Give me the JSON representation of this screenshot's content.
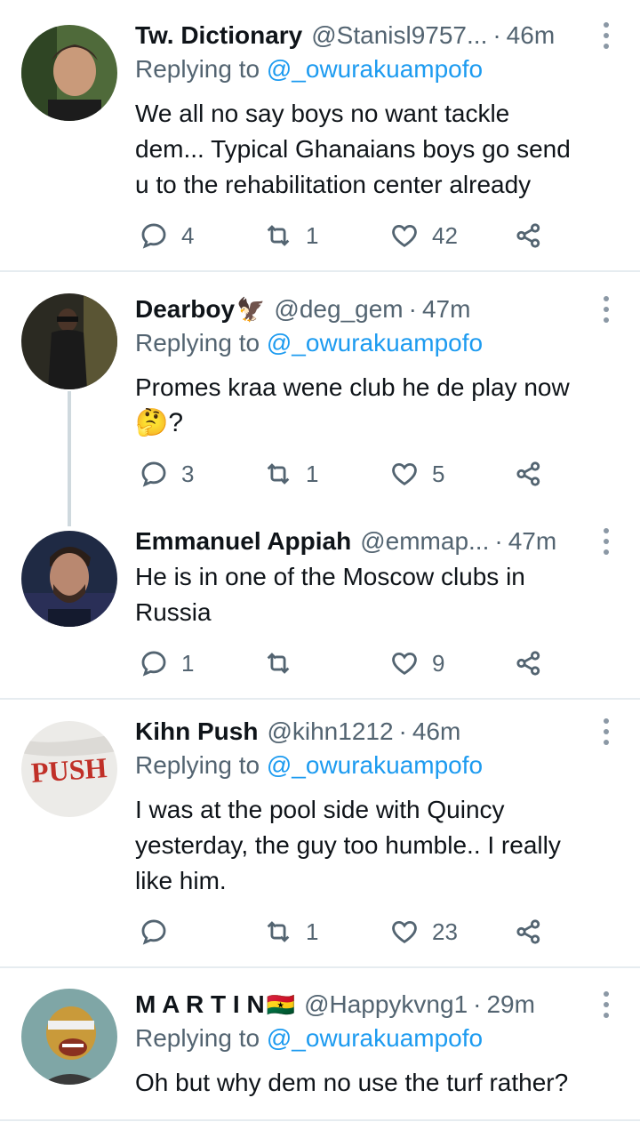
{
  "tweets": [
    {
      "name": "Tw. Dictionary",
      "badge": "",
      "handle": "@Stanisl9757...",
      "time": "46m",
      "replying_prefix": "Replying to ",
      "replying_handle": "@_owurakuampofo",
      "lines": [
        "We all no say boys no want tackle",
        "dem... Typical Ghanaians boys go send",
        "u to the rehabilitation center already"
      ],
      "replies": "4",
      "retweets": "1",
      "likes": "42"
    },
    {
      "name": "Dearboy",
      "badge": "🦅",
      "handle": "@deg_gem",
      "time": "47m",
      "replying_prefix": "Replying to ",
      "replying_handle": "@_owurakuampofo",
      "lines": [
        "Promes kraa wene club he de play now",
        "🤔?"
      ],
      "replies": "3",
      "retweets": "1",
      "likes": "5"
    },
    {
      "name": "Emmanuel Appiah",
      "badge": "",
      "handle": "@emmap...",
      "time": "47m",
      "lines": [
        "He is in one of the Moscow clubs in",
        "Russia"
      ],
      "replies": "1",
      "retweets": "",
      "likes": "9"
    },
    {
      "name": "Kihn Push",
      "badge": "",
      "handle": "@kihn1212",
      "time": "46m",
      "replying_prefix": "Replying to ",
      "replying_handle": "@_owurakuampofo",
      "lines": [
        "I was at the pool side with Quincy",
        "yesterday, the guy too humble.. I really",
        "like him."
      ],
      "replies": "",
      "retweets": "1",
      "likes": "23"
    },
    {
      "name": "M A R T I N",
      "badge": "🇬🇭",
      "handle": "@Happykvng1",
      "time": "29m",
      "replying_prefix": "Replying to ",
      "replying_handle": "@_owurakuampofo",
      "lines": [
        "Oh but why dem no use the turf rather?"
      ]
    }
  ],
  "avatar_texts": {
    "push": "PUSH"
  },
  "separator": "·",
  "icons": [
    "reply-icon",
    "retweet-icon",
    "like-icon",
    "share-icon",
    "more-icon"
  ],
  "colors": {
    "link": "#1d9bf0",
    "secondary": "#536471",
    "text": "#0f1419",
    "divider": "#e6ecf0"
  }
}
